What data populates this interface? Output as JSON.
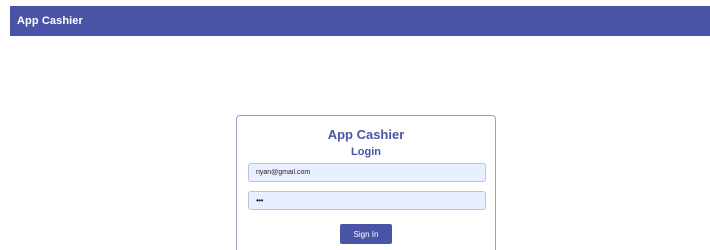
{
  "header": {
    "title": "App Cashier",
    "color": "#4a54a6"
  },
  "login": {
    "title": "App Cashier",
    "subtitle": "Login",
    "email": {
      "value": "riyan@gmail.com",
      "type": "email"
    },
    "password": {
      "value": "•••",
      "type": "password"
    },
    "submit_label": "Sign In",
    "accent_color": "#4a54a6",
    "field_background": "#e8efff"
  }
}
